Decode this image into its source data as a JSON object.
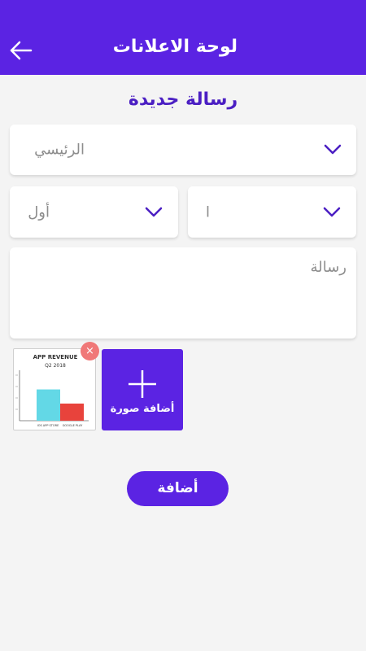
{
  "colors": {
    "brand": "#5b23e3",
    "heading": "#4b1fc3",
    "placeholder": "#8d8d8d",
    "remove": "#f07878"
  },
  "appbar": {
    "title": "لوحة الاعلانات",
    "back_icon": "arrow-left-icon"
  },
  "page": {
    "heading": "رسالة جديدة"
  },
  "form": {
    "main_select": {
      "value": "الرئيسي",
      "icon": "chevron-down-icon"
    },
    "second_select": {
      "value": "ا",
      "icon": "chevron-down-icon"
    },
    "first_select": {
      "value": "أول",
      "icon": "chevron-down-icon"
    },
    "message": {
      "placeholder": "رسالة",
      "value": ""
    }
  },
  "attachments": {
    "thumbnail": {
      "title": "APP REVENUE",
      "subtitle": "Q2 2018",
      "bars": [
        {
          "label": "IOS APP STORE",
          "color": "#63d8e6",
          "value": 0.62
        },
        {
          "label": "GOOGLE PLAY",
          "color": "#e8433c",
          "value": 0.34
        }
      ]
    },
    "remove_icon": "×",
    "add_image_label": "أضافة صورة",
    "add_icon": "plus-icon"
  },
  "submit_label": "أضافة"
}
